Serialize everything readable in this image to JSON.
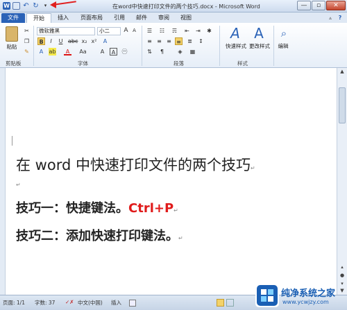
{
  "window": {
    "title": "在word中快速打印文件的两个技巧.docx - Microsoft Word"
  },
  "tabs": [
    "文件",
    "开始",
    "插入",
    "页面布局",
    "引用",
    "邮件",
    "审阅",
    "视图"
  ],
  "ribbon": {
    "clipboard": {
      "paste_label": "粘贴",
      "group_label": "剪贴板"
    },
    "font": {
      "font_name": "微软雅黑",
      "font_size": "小二",
      "group_label": "字体",
      "bold": "B",
      "italic": "I",
      "underline": "U"
    },
    "paragraph": {
      "group_label": "段落"
    },
    "styles": {
      "quick_styles_label": "快速样式",
      "change_styles_label": "更改样式",
      "group_label": "样式"
    },
    "editing": {
      "label": "编辑"
    }
  },
  "document": {
    "heading": "在 word 中快速打印文件的两个技巧",
    "tip1_prefix": "技巧一：快捷键法。",
    "tip1_shortcut": "Ctrl+P",
    "tip2": "技巧二：添加快速打印键法。",
    "para_mark": "↵"
  },
  "status": {
    "page": "页面: 1/1",
    "words": "字数: 37",
    "language": "中文(中国)",
    "mode": "插入"
  },
  "watermark": {
    "brand": "纯净系统之家",
    "url": "www.ycwjzy.com"
  },
  "colors": {
    "accent": "#2a62b7",
    "highlight": "#e01b1b"
  }
}
